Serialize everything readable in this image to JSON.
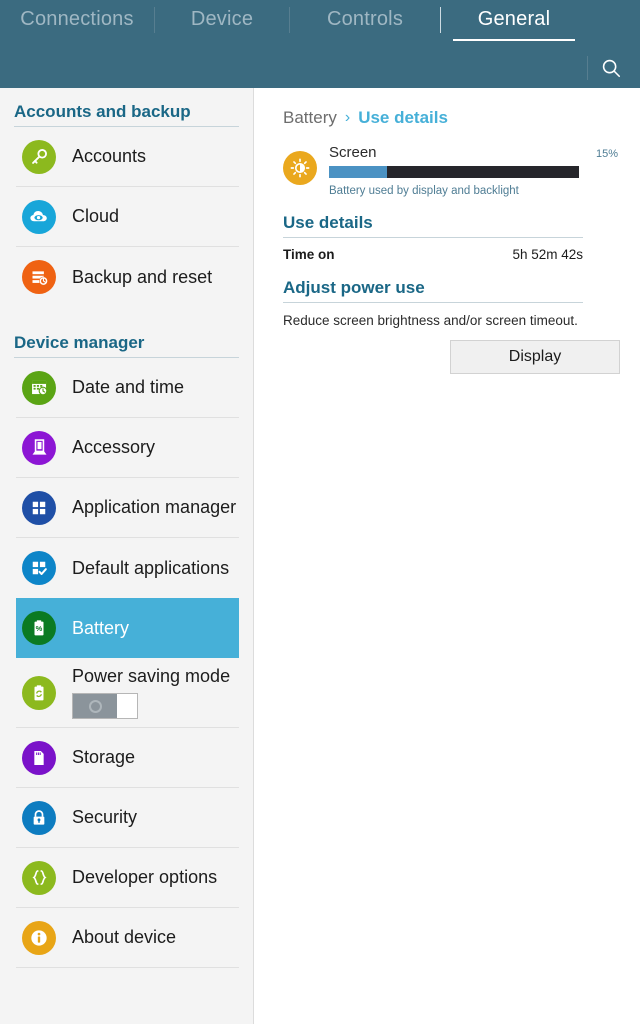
{
  "header": {
    "tabs": [
      {
        "label": "Connections",
        "active": false
      },
      {
        "label": "Device",
        "active": false
      },
      {
        "label": "Controls",
        "active": false
      },
      {
        "label": "General",
        "active": true
      }
    ],
    "search_icon": "search-icon",
    "background_color": "#3b6b80",
    "active_tab_color": "#ffffff",
    "inactive_tab_color": "#9fb7c3"
  },
  "sidebar": {
    "background_color": "#f4f4f4",
    "selected_color": "#46b0d8",
    "section_header_color": "#1a6786",
    "sections": [
      {
        "title": "Accounts and backup",
        "items": [
          {
            "label": "Accounts",
            "icon": "key-icon",
            "icon_color": "#8cb91e"
          },
          {
            "label": "Cloud",
            "icon": "cloud-eye-icon",
            "icon_color": "#18a6d9"
          },
          {
            "label": "Backup and reset",
            "icon": "backup-restore-icon",
            "icon_color": "#ef6212"
          }
        ]
      },
      {
        "title": "Device manager",
        "items": [
          {
            "label": "Date and time",
            "icon": "calendar-clock-icon",
            "icon_color": "#5aa414"
          },
          {
            "label": "Accessory",
            "icon": "dock-icon",
            "icon_color": "#8c16d4"
          },
          {
            "label": "Application manager",
            "icon": "grid-icon",
            "icon_color": "#1f4fa6"
          },
          {
            "label": "Default applications",
            "icon": "grid-check-icon",
            "icon_color": "#0d85c8"
          },
          {
            "label": "Battery",
            "icon": "battery-percent-icon",
            "icon_color": "#0b7a22",
            "selected": true
          },
          {
            "label": "Power saving mode",
            "icon": "battery-recycle-icon",
            "icon_color": "#8cb91e",
            "toggle": "off"
          },
          {
            "label": "Storage",
            "icon": "sdcard-icon",
            "icon_color": "#7a12c9"
          },
          {
            "label": "Security",
            "icon": "lock-icon",
            "icon_color": "#0d7cc0"
          },
          {
            "label": "Developer options",
            "icon": "braces-icon",
            "icon_color": "#8cb91e"
          },
          {
            "label": "About device",
            "icon": "info-icon",
            "icon_color": "#e8a516"
          }
        ]
      }
    ]
  },
  "content": {
    "breadcrumb": {
      "root": "Battery",
      "separator": "›",
      "current": "Use details"
    },
    "usage": {
      "icon": "brightness-icon",
      "icon_color": "#eaa81e",
      "name": "Screen",
      "percent_label": "15%",
      "bar_fill_percent": 23,
      "bar_fill_color": "#4b92c3",
      "bar_track_color": "#26262b",
      "description": "Battery used by display and backlight"
    },
    "use_details": {
      "title": "Use details",
      "rows": [
        {
          "key": "Time on",
          "value": "5h 52m 42s"
        }
      ]
    },
    "adjust_power_use": {
      "title": "Adjust power use",
      "hint": "Reduce screen brightness and/or screen timeout.",
      "button_label": "Display"
    }
  }
}
